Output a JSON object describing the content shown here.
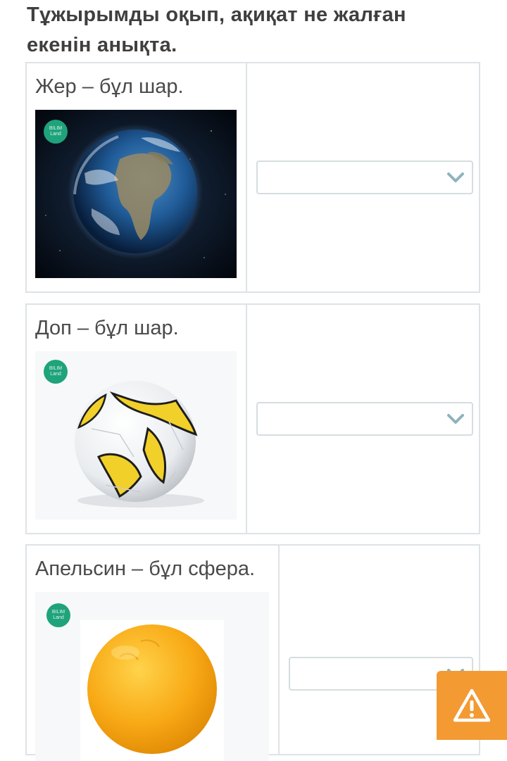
{
  "task": {
    "title_line1": "Тұжырымды оқып, ақиқат не жалған",
    "title_line2": "екенін анықта."
  },
  "rows": [
    {
      "statement": "Жер – бұл шар.",
      "image": "earth-image",
      "answer": ""
    },
    {
      "statement": "Доп – бұл шар.",
      "image": "soccer-ball-image",
      "answer": ""
    },
    {
      "statement": "Апельсин – бұл сфера.",
      "image": "orange-image",
      "answer": ""
    }
  ],
  "logo": {
    "line1": "BILIM",
    "line2": "Land"
  },
  "icons": {
    "dropdown": "chevron-down-icon",
    "alert": "warning-icon"
  },
  "colors": {
    "border": "#dde3e6",
    "chevron": "#8fb3bd",
    "logo_green": "#1fa37a",
    "alert_orange": "#f39a33"
  }
}
